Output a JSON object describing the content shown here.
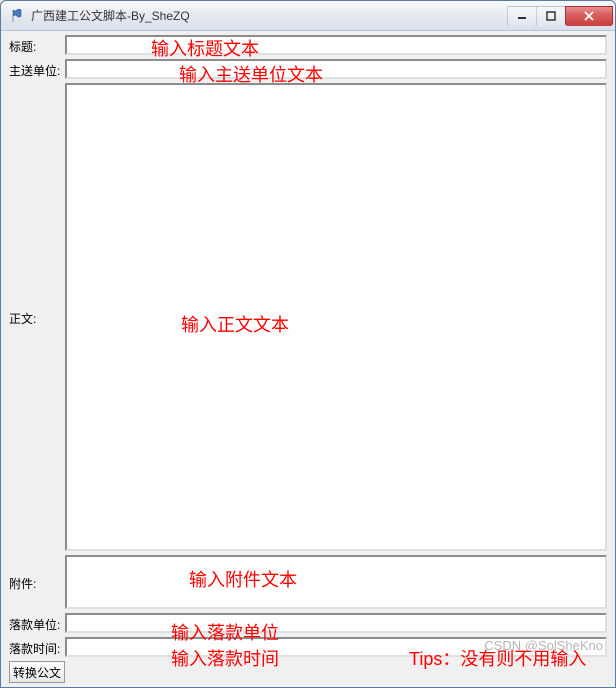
{
  "window": {
    "title": "广西建工公文脚本-By_SheZQ"
  },
  "labels": {
    "title": "标题:",
    "addressee": "主送单位:",
    "body": "正文:",
    "attachment": "附件:",
    "signUnit": "落款单位:",
    "signTime": "落款时间:"
  },
  "fields": {
    "title": "",
    "addressee": "",
    "body": "",
    "attachment": "",
    "signUnit": "",
    "signTime": ""
  },
  "buttons": {
    "convert": "转换公文"
  },
  "annotations": {
    "title": "输入标题文本",
    "addressee": "输入主送单位文本",
    "body": "输入正文文本",
    "attachment": "输入附件文本",
    "signUnit": "输入落款单位",
    "signTime": "输入落款时间",
    "tips": "Tips：没有则不用输入"
  },
  "watermark": "CSDN @SolSheKno"
}
